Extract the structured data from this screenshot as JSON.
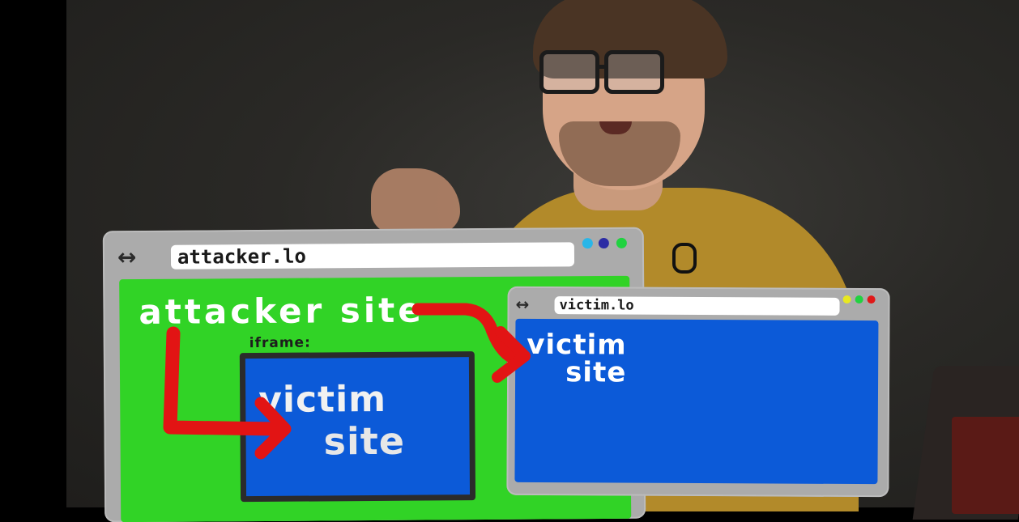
{
  "attacker_window": {
    "url": "attacker.lo",
    "nav_arrows": "↔",
    "heading": "attacker site",
    "iframe_label": "iframe:",
    "iframe_content": {
      "line1": "victim",
      "line2": "site"
    },
    "window_dots": [
      "#29b6e8",
      "#2c2ca4",
      "#21d240"
    ],
    "page_color": "#31d326"
  },
  "victim_window": {
    "url": "victim.lo",
    "nav_arrows": "↔",
    "content": {
      "line1": "victim",
      "line2": "site"
    },
    "window_dots": [
      "#e8e820",
      "#21d240",
      "#e01818"
    ],
    "page_color": "#0c5ad8"
  },
  "arrow_color": "#e21414"
}
